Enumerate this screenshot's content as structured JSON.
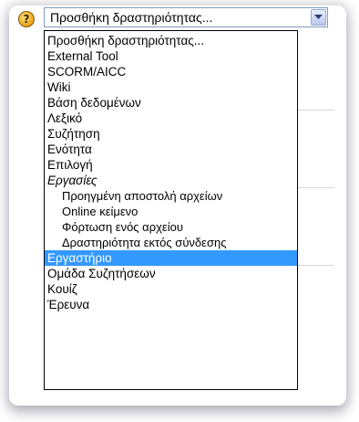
{
  "select": {
    "value": "Προσθήκη δραστηριότητας...",
    "help_icon": "help-icon",
    "arrow_icon": "chevron-down-icon"
  },
  "options": [
    {
      "label": "Προσθήκη δραστηριότητας...",
      "type": "normal"
    },
    {
      "label": "External Tool",
      "type": "normal"
    },
    {
      "label": "SCORM/AICC",
      "type": "normal"
    },
    {
      "label": "Wiki",
      "type": "normal"
    },
    {
      "label": "Βάση δεδομένων",
      "type": "normal"
    },
    {
      "label": "Λεξικό",
      "type": "normal"
    },
    {
      "label": "Συζήτηση",
      "type": "normal"
    },
    {
      "label": "Ενότητα",
      "type": "normal"
    },
    {
      "label": "Επιλογή",
      "type": "normal"
    },
    {
      "label": "Εργασίες",
      "type": "group"
    },
    {
      "label": "Προηγμένη αποστολή αρχείων",
      "type": "sub"
    },
    {
      "label": "Online κείμενο",
      "type": "sub"
    },
    {
      "label": "Φόρτωση ενός αρχείου",
      "type": "sub"
    },
    {
      "label": "Δραστηριότητα εκτός σύνδεσης",
      "type": "sub"
    },
    {
      "label": "Εργαστήριο",
      "type": "selected"
    },
    {
      "label": "Ομάδα Συζητήσεων",
      "type": "normal"
    },
    {
      "label": "Κουίζ",
      "type": "normal"
    },
    {
      "label": "Έρευνα",
      "type": "normal"
    }
  ]
}
